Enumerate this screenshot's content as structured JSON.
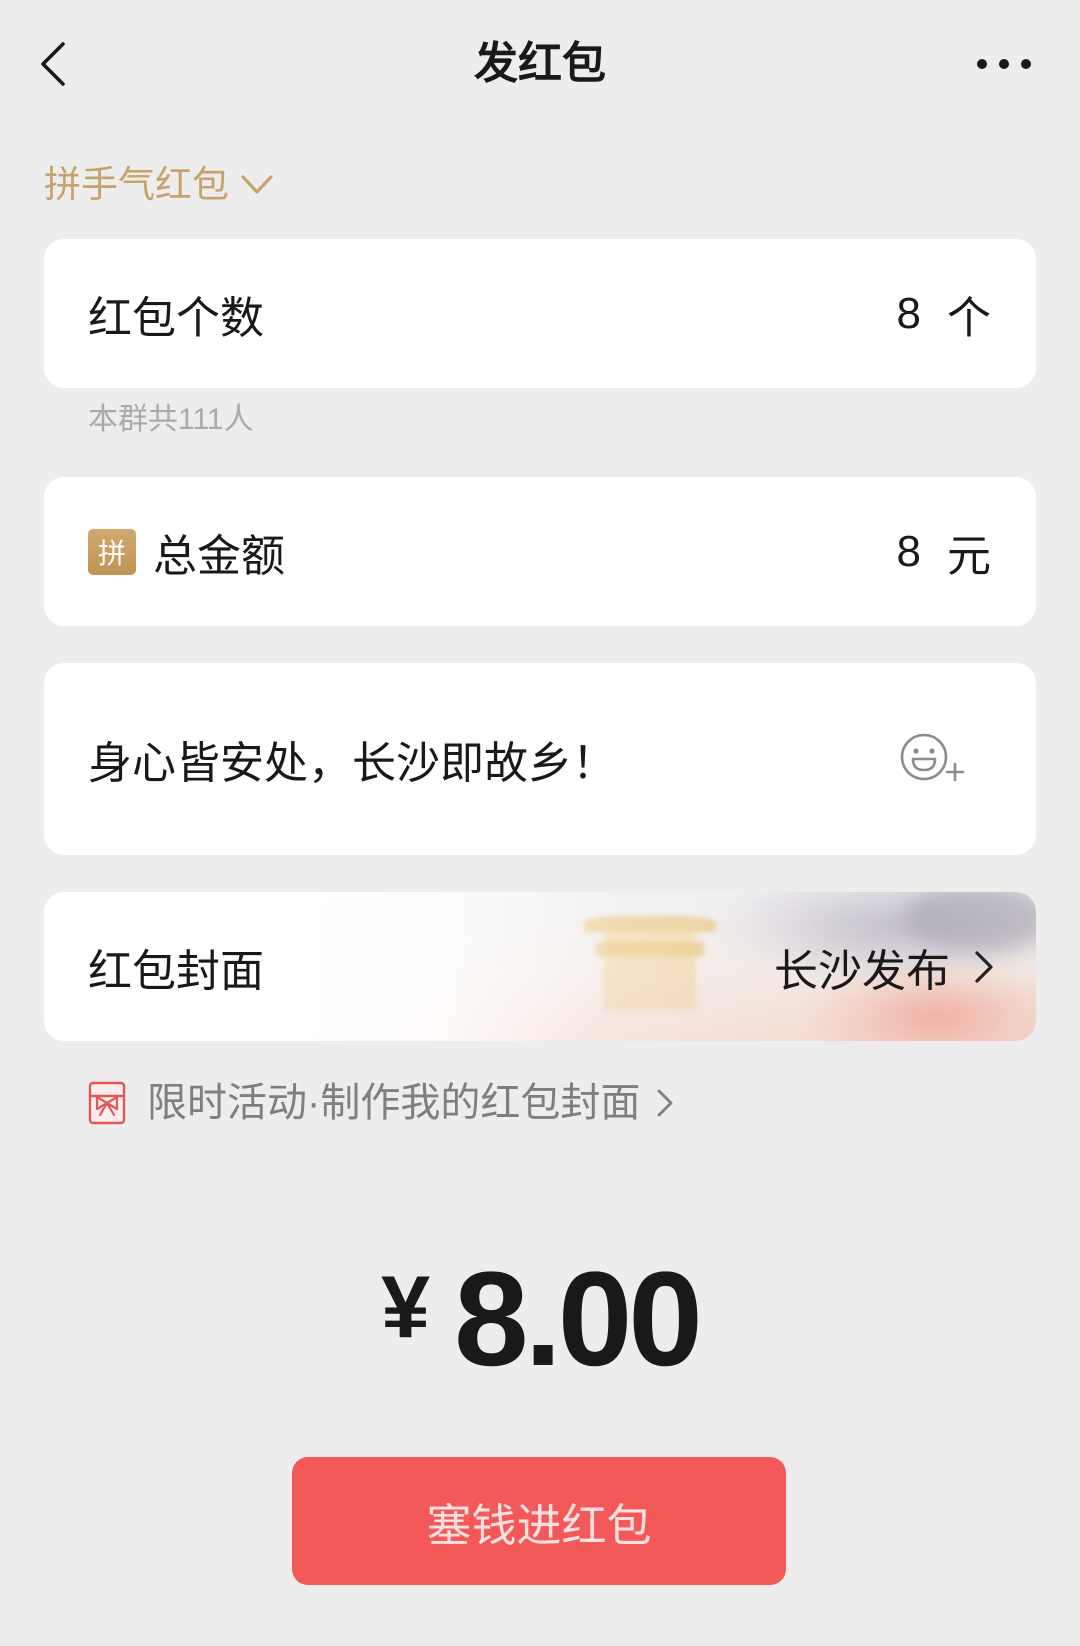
{
  "header": {
    "title": "发红包",
    "back_icon": "chevron-left-icon",
    "more_icon": "more-dots-icon"
  },
  "packet_type": {
    "label": "拼手气红包",
    "icon": "chevron-down-icon"
  },
  "count": {
    "label": "红包个数",
    "value": "8",
    "unit": "个",
    "hint": "本群共111人"
  },
  "amount": {
    "badge": "拼",
    "label": "总金额",
    "value": "8",
    "unit": "元"
  },
  "message": {
    "value": "身心皆安处，长沙即故乡！",
    "emoji_icon": "emoji-add-icon"
  },
  "cover": {
    "label": "红包封面",
    "value": "长沙发布",
    "icon": "chevron-right-icon"
  },
  "promo": {
    "icon": "red-packet-gift-icon",
    "text": "限时活动·制作我的红包封面",
    "arrow_icon": "chevron-right-icon"
  },
  "total": {
    "currency": "¥",
    "amount": "8.00"
  },
  "submit": {
    "label": "塞钱进红包"
  },
  "colors": {
    "background": "#ededed",
    "card": "#ffffff",
    "accent_gold": "#c5a36c",
    "text_primary": "#191919",
    "text_secondary": "#aaaaaa",
    "promo_text": "#7f7f7f",
    "promo_icon_red": "#e25656",
    "icon_gray": "#8c8c8c",
    "button_red": "#f45959",
    "button_text": "#fde1e1"
  }
}
